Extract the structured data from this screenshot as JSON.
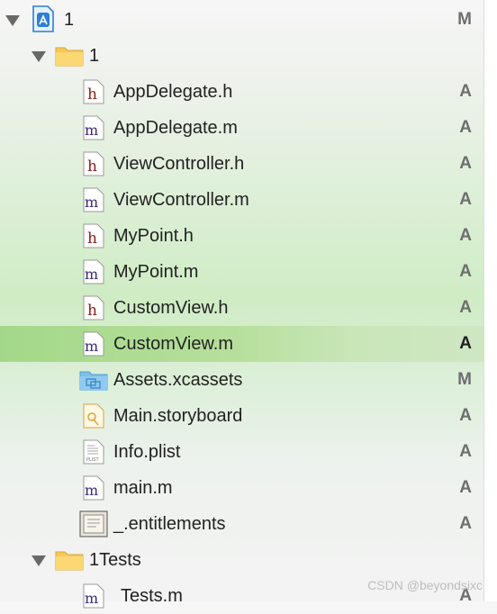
{
  "navigator": {
    "rows": [
      {
        "name": "1",
        "kind": "project",
        "status": "M",
        "expanded": true
      },
      {
        "name": "1",
        "kind": "folder",
        "status": "",
        "expanded": true
      },
      {
        "name": "AppDelegate.h",
        "kind": "h",
        "status": "A"
      },
      {
        "name": "AppDelegate.m",
        "kind": "m",
        "status": "A"
      },
      {
        "name": "ViewController.h",
        "kind": "h",
        "status": "A"
      },
      {
        "name": "ViewController.m",
        "kind": "m",
        "status": "A"
      },
      {
        "name": "MyPoint.h",
        "kind": "h",
        "status": "A"
      },
      {
        "name": "MyPoint.m",
        "kind": "m",
        "status": "A"
      },
      {
        "name": "CustomView.h",
        "kind": "h",
        "status": "A"
      },
      {
        "name": "CustomView.m",
        "kind": "m",
        "status": "A",
        "selected": true
      },
      {
        "name": "Assets.xcassets",
        "kind": "assets",
        "status": "M"
      },
      {
        "name": "Main.storyboard",
        "kind": "storyboard",
        "status": "A"
      },
      {
        "name": "Info.plist",
        "kind": "plist",
        "status": "A"
      },
      {
        "name": "main.m",
        "kind": "m",
        "status": "A"
      },
      {
        "name": "_.entitlements",
        "kind": "entitlements",
        "status": "A"
      },
      {
        "name": "1Tests",
        "kind": "folder",
        "status": "",
        "expanded": true
      },
      {
        "name": "Tests.m",
        "kind": "m",
        "status": "A"
      }
    ]
  },
  "icon_labels": {
    "h": "h",
    "m": "m",
    "plist": "PLIST"
  },
  "colors": {
    "selected_row": "#a4d889",
    "header_letter": "#8b1a1a",
    "impl_letter": "#3a2a7a",
    "folder": "#f6c957",
    "assets": "#7fbfea"
  },
  "watermark": "CSDN @beyondsixc"
}
